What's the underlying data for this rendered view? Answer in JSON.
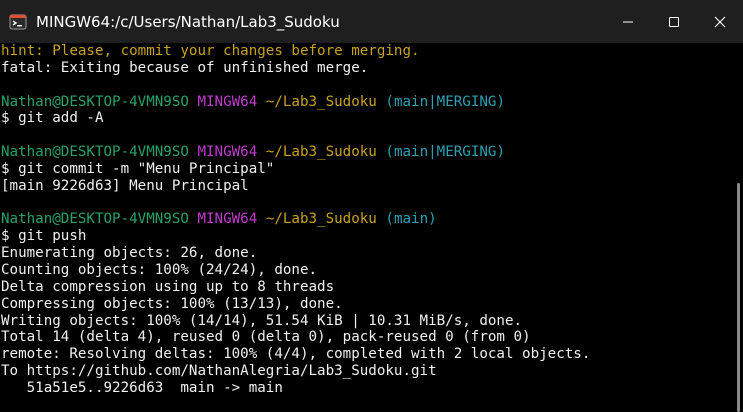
{
  "window": {
    "title": "MINGW64:/c/Users/Nathan/Lab3_Sudoku",
    "icon": "git-bash-icon",
    "controls": [
      "minimize-icon",
      "maximize-icon",
      "close-icon"
    ]
  },
  "colors": {
    "background": "#000000",
    "text": "#f0f0f0",
    "hint_yellow": "#c8a21b",
    "user_green": "#26a269",
    "mingw_magenta": "#c43bd0",
    "path_yellow": "#c8a21b",
    "branch_cyan": "#2aa1b3"
  },
  "terminal": {
    "l1": "hint: Please, commit your changes before merging.",
    "l2": "fatal: Exiting because of unfinished merge.",
    "p1": {
      "user": "Nathan@DESKTOP-4VMN9SO",
      "env": "MINGW64",
      "path": "~/Lab3_Sudoku",
      "branch": "(main|MERGING)"
    },
    "c1": "$ git add -A",
    "p2": {
      "user": "Nathan@DESKTOP-4VMN9SO",
      "env": "MINGW64",
      "path": "~/Lab3_Sudoku",
      "branch": "(main|MERGING)"
    },
    "c2": "$ git commit -m \"Menu Principal\"",
    "o2": "[main 9226d63] Menu Principal",
    "p3": {
      "user": "Nathan@DESKTOP-4VMN9SO",
      "env": "MINGW64",
      "path": "~/Lab3_Sudoku",
      "branch": "(main)"
    },
    "c3": "$ git push",
    "o3": [
      "Enumerating objects: 26, done.",
      "Counting objects: 100% (24/24), done.",
      "Delta compression using up to 8 threads",
      "Compressing objects: 100% (13/13), done.",
      "Writing objects: 100% (14/14), 51.54 KiB | 10.31 MiB/s, done.",
      "Total 14 (delta 4), reused 0 (delta 0), pack-reused 0 (from 0)",
      "remote: Resolving deltas: 100% (4/4), completed with 2 local objects.",
      "To https://github.com/NathanAlegria/Lab3_Sudoku.git",
      "   51a51e5..9226d63  main -> main"
    ]
  }
}
